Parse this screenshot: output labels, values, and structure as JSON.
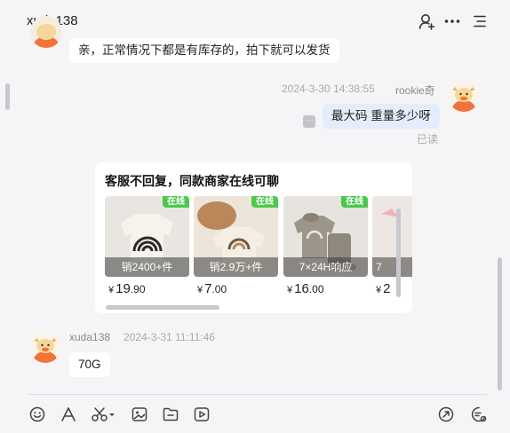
{
  "header": {
    "title": "xuda138",
    "icons": [
      "add-contact-icon",
      "more-icon",
      "menu-icon"
    ]
  },
  "messages": [
    {
      "side": "left",
      "text": "亲，正常情况下都是有库存的，拍下就可以发货"
    },
    {
      "side": "right",
      "timestamp": "2024-3-30 14:38:55",
      "sender": "rookie奇",
      "text": "最大码 重量多少呀",
      "status": "已读"
    }
  ],
  "recommend_card": {
    "title": "客服不回复，同款商家在线可聊",
    "products": [
      {
        "tag": "在线",
        "sales": "销2400+件",
        "currency": "¥",
        "price_int": "19",
        "price_dec": ".90"
      },
      {
        "tag": "在线",
        "sales": "销2.9万+件",
        "currency": "¥",
        "price_int": "7",
        "price_dec": ".00"
      },
      {
        "tag": "在线",
        "sales": "7×24H响应",
        "currency": "¥",
        "price_int": "16",
        "price_dec": ".00"
      },
      {
        "tag": "",
        "sales": "7",
        "currency": "¥",
        "price_int": "2",
        "price_dec": ""
      }
    ]
  },
  "last_message": {
    "sender": "xuda138",
    "timestamp": "2024-3-31 11:11:46",
    "text": "70G"
  },
  "toolbar": {
    "icons": [
      "emoji-icon",
      "font-icon",
      "screenshot-scissors-icon",
      "image-icon",
      "folder-icon",
      "video-icon",
      "send-link-icon",
      "chat-settings-icon"
    ]
  },
  "colors": {
    "background": "#f5f5f7",
    "own_bubble": "#e3edfc",
    "online_tag": "#4cc84c",
    "avatar_orange": "#f0733a"
  }
}
